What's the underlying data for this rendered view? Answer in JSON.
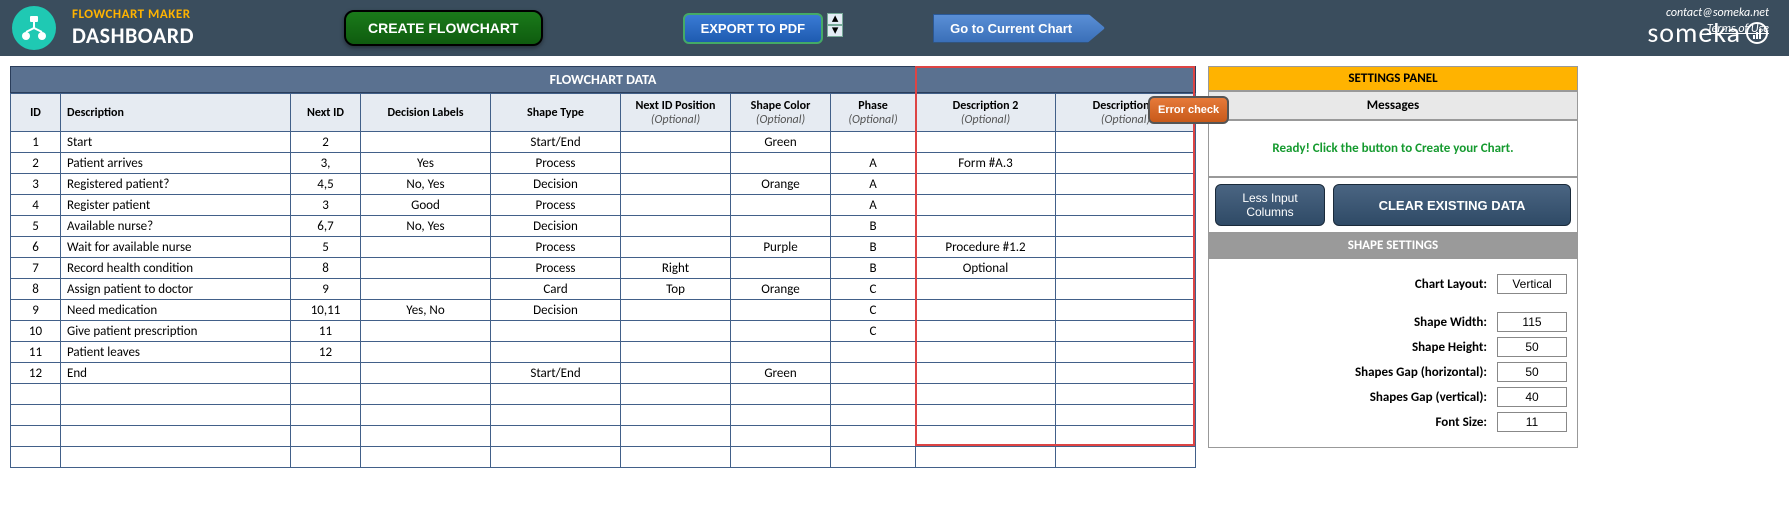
{
  "header": {
    "title_top": "FLOWCHART MAKER",
    "title_main": "DASHBOARD",
    "btn_create": "CREATE FLOWCHART",
    "btn_export": "EXPORT TO PDF",
    "btn_goto": "Go to Current Chart",
    "contact": "contact@someka.net",
    "terms": "Terms of Use",
    "brand": "someka"
  },
  "table": {
    "header": "FLOWCHART DATA",
    "cols": {
      "id": "ID",
      "desc": "Description",
      "next": "Next ID",
      "labels": "Decision Labels",
      "shape": "Shape Type",
      "nextpos": "Next ID Position",
      "color": "Shape Color",
      "phase": "Phase",
      "desc2": "Description 2",
      "desc3": "Description 3",
      "opt": "(Optional)"
    },
    "rows": [
      {
        "id": "1",
        "desc": "Start",
        "next": "2",
        "labels": "",
        "shape": "Start/End",
        "nextpos": "",
        "color": "Green",
        "phase": "",
        "desc2": "",
        "desc3": ""
      },
      {
        "id": "2",
        "desc": "Patient arrives",
        "next": "3,",
        "labels": "Yes",
        "shape": "Process",
        "nextpos": "",
        "color": "",
        "phase": "A",
        "desc2": "Form #A.3",
        "desc3": ""
      },
      {
        "id": "3",
        "desc": "Registered patient?",
        "next": "4,5",
        "labels": "No, Yes",
        "shape": "Decision",
        "nextpos": "",
        "color": "Orange",
        "phase": "A",
        "desc2": "",
        "desc3": ""
      },
      {
        "id": "4",
        "desc": "Register patient",
        "next": "3",
        "labels": "Good",
        "shape": "Process",
        "nextpos": "",
        "color": "",
        "phase": "A",
        "desc2": "",
        "desc3": ""
      },
      {
        "id": "5",
        "desc": "Available nurse?",
        "next": "6,7",
        "labels": "No, Yes",
        "shape": "Decision",
        "nextpos": "",
        "color": "",
        "phase": "B",
        "desc2": "",
        "desc3": ""
      },
      {
        "id": "6",
        "desc": "Wait for available nurse",
        "next": "5",
        "labels": "",
        "shape": "Process",
        "nextpos": "",
        "color": "Purple",
        "phase": "B",
        "desc2": "Procedure #1.2",
        "desc3": ""
      },
      {
        "id": "7",
        "desc": "Record health condition",
        "next": "8",
        "labels": "",
        "shape": "Process",
        "nextpos": "Right",
        "color": "",
        "phase": "B",
        "desc2": "Optional",
        "desc3": ""
      },
      {
        "id": "8",
        "desc": "Assign patient to doctor",
        "next": "9",
        "labels": "",
        "shape": "Card",
        "nextpos": "Top",
        "color": "Orange",
        "phase": "C",
        "desc2": "",
        "desc3": ""
      },
      {
        "id": "9",
        "desc": "Need medication",
        "next": "10,11",
        "labels": "Yes, No",
        "shape": "Decision",
        "nextpos": "",
        "color": "",
        "phase": "C",
        "desc2": "",
        "desc3": ""
      },
      {
        "id": "10",
        "desc": "Give patient prescription",
        "next": "11",
        "labels": "",
        "shape": "",
        "nextpos": "",
        "color": "",
        "phase": "C",
        "desc2": "",
        "desc3": ""
      },
      {
        "id": "11",
        "desc": "Patient leaves",
        "next": "12",
        "labels": "",
        "shape": "",
        "nextpos": "",
        "color": "",
        "phase": "",
        "desc2": "",
        "desc3": ""
      },
      {
        "id": "12",
        "desc": "End",
        "next": "",
        "labels": "",
        "shape": "Start/End",
        "nextpos": "",
        "color": "Green",
        "phase": "",
        "desc2": "",
        "desc3": ""
      },
      {
        "id": "",
        "desc": "",
        "next": "",
        "labels": "",
        "shape": "",
        "nextpos": "",
        "color": "",
        "phase": "",
        "desc2": "",
        "desc3": ""
      },
      {
        "id": "",
        "desc": "",
        "next": "",
        "labels": "",
        "shape": "",
        "nextpos": "",
        "color": "",
        "phase": "",
        "desc2": "",
        "desc3": ""
      },
      {
        "id": "",
        "desc": "",
        "next": "",
        "labels": "",
        "shape": "",
        "nextpos": "",
        "color": "",
        "phase": "",
        "desc2": "",
        "desc3": ""
      },
      {
        "id": "",
        "desc": "",
        "next": "",
        "labels": "",
        "shape": "",
        "nextpos": "",
        "color": "",
        "phase": "",
        "desc2": "",
        "desc3": ""
      }
    ]
  },
  "panel": {
    "title": "SETTINGS PANEL",
    "error_check": "Error check",
    "messages": "Messages",
    "msg_text": "Ready! Click the button to Create your Chart.",
    "btn_less": "Less Input Columns",
    "btn_clear": "CLEAR EXISTING DATA",
    "shape_settings": "SHAPE SETTINGS",
    "layout_label": "Chart Layout:",
    "layout_value": "Vertical",
    "width_label": "Shape Width:",
    "width_value": "115",
    "height_label": "Shape Height:",
    "height_value": "50",
    "gaph_label": "Shapes Gap (horizontal):",
    "gaph_value": "50",
    "gapv_label": "Shapes Gap (vertical):",
    "gapv_value": "40",
    "font_label": "Font Size:",
    "font_value": "11"
  }
}
